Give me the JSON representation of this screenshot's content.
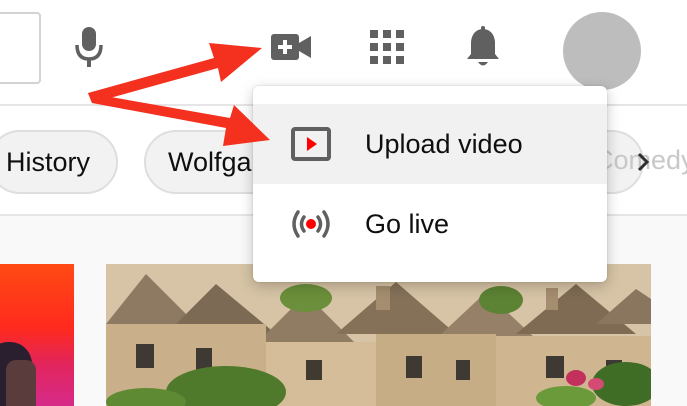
{
  "header": {
    "icons": {
      "mic": "microphone-icon",
      "create": "create-video-icon",
      "apps": "apps-grid-icon",
      "notifications": "bell-icon",
      "avatar": "avatar"
    }
  },
  "chips": {
    "items": [
      {
        "label": "History"
      },
      {
        "label": "Wolfgang Amadeus Mozart"
      }
    ],
    "faded_label": "Comedy"
  },
  "create_menu": {
    "items": [
      {
        "label": "Upload video",
        "icon": "upload-video-icon",
        "highlighted": true
      },
      {
        "label": "Go live",
        "icon": "go-live-icon",
        "highlighted": false
      }
    ]
  },
  "colors": {
    "icon": "#606060",
    "menu_highlight": "#f1f1f1",
    "play_red": "#ff0000",
    "annotation_arrow": "#f4301e",
    "avatar": "#bdbdbd"
  }
}
